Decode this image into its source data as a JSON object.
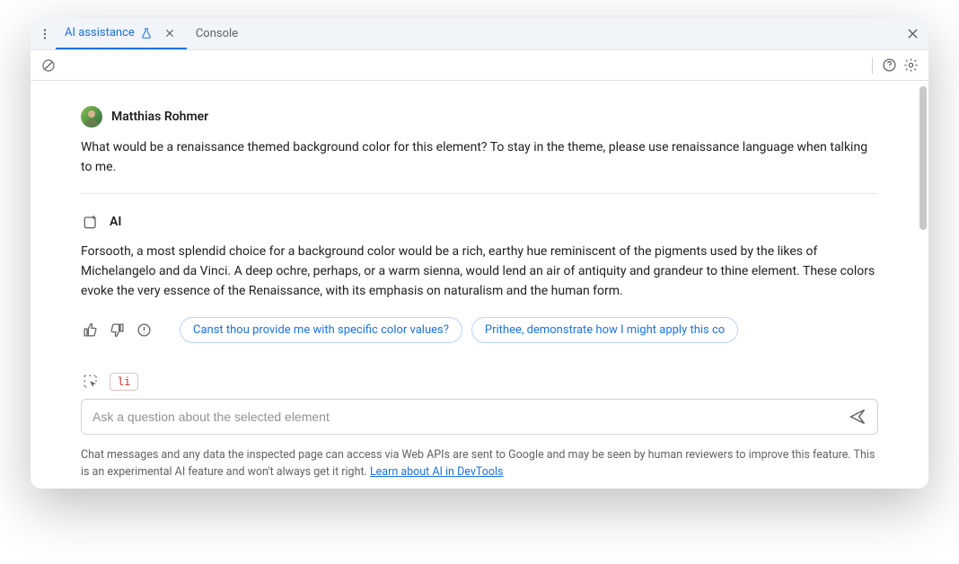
{
  "tabs": {
    "active": {
      "label": "AI assistance"
    },
    "secondary": {
      "label": "Console"
    }
  },
  "messages": {
    "user": {
      "name": "Matthias Rohmer",
      "body": "What would be a renaissance themed background color for this element? To stay in the theme, please use renaissance language when talking to me."
    },
    "ai": {
      "name": "AI",
      "body": "Forsooth, a most splendid choice for a background color would be a rich, earthy hue reminiscent of the pigments used by the likes of Michelangelo and da Vinci. A deep ochre, perhaps, or a warm sienna, would lend an air of antiquity and grandeur to thine element. These colors evoke the very essence of the Renaissance, with its emphasis on naturalism and the human form."
    }
  },
  "suggestions": [
    "Canst thou provide me with specific color values?",
    "Prithee, demonstrate how I might apply this co"
  ],
  "context_element": "li",
  "input": {
    "placeholder": "Ask a question about the selected element"
  },
  "footer": {
    "text": "Chat messages and any data the inspected page can access via Web APIs are sent to Google and may be seen by human reviewers to improve this feature. This is an experimental AI feature and won't always get it right. ",
    "link_text": "Learn about AI in DevTools"
  }
}
